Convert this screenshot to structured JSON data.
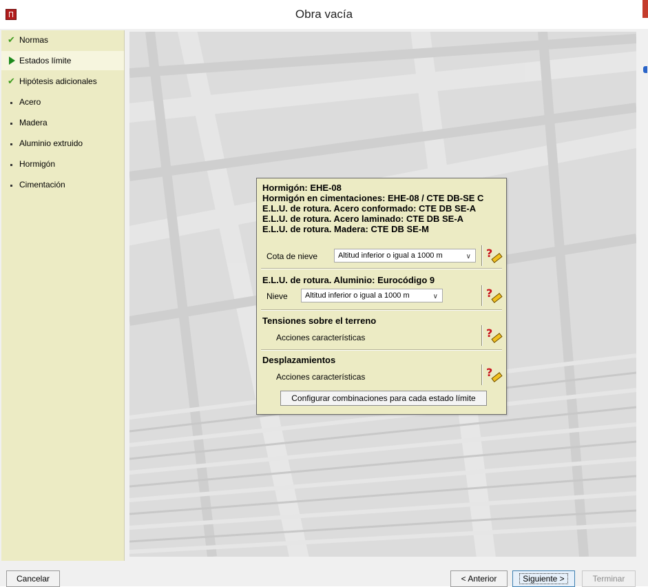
{
  "window": {
    "title": "Obra vacía",
    "close_label": "×"
  },
  "sidebar": {
    "items": [
      {
        "label": "Normas",
        "icon": "check-icon",
        "active": false
      },
      {
        "label": "Estados límite",
        "icon": "arrow-icon",
        "active": true
      },
      {
        "label": "Hipótesis adicionales",
        "icon": "check-icon",
        "active": false
      },
      {
        "label": "Acero",
        "icon": "bullet-icon",
        "active": false
      },
      {
        "label": "Madera",
        "icon": "bullet-icon",
        "active": false
      },
      {
        "label": "Aluminio extruido",
        "icon": "bullet-icon",
        "active": false
      },
      {
        "label": "Hormigón",
        "icon": "bullet-icon",
        "active": false
      },
      {
        "label": "Cimentación",
        "icon": "bullet-icon",
        "active": false
      }
    ]
  },
  "panel": {
    "lines": [
      "Hormigón: EHE-08",
      "Hormigón en cimentaciones: EHE-08 / CTE DB-SE C",
      "E.L.U. de rotura. Acero conformado: CTE DB SE-A",
      "E.L.U. de rotura. Acero laminado: CTE DB SE-A",
      "E.L.U. de rotura. Madera: CTE DB SE-M"
    ],
    "cota_label": "Cota de nieve",
    "cota_value": "Altitud inferior o igual a 1000 m",
    "aluminio_title": "E.L.U. de rotura. Aluminio: Eurocódigo 9",
    "nieve_label": "Nieve",
    "nieve_value": "Altitud inferior o igual a 1000 m",
    "tensiones_title": "Tensiones sobre el terreno",
    "tensiones_sub": "Acciones características",
    "desplazamientos_title": "Desplazamientos",
    "desplazamientos_sub": "Acciones características",
    "config_button": "Configurar combinaciones para cada estado límite"
  },
  "footer": {
    "cancel": "Cancelar",
    "previous": "< Anterior",
    "next": "Siguiente >",
    "finish": "Terminar"
  },
  "colors": {
    "panel_bg": "#ecebc4",
    "sidebar_bg": "#ecebc4",
    "canvas_bg": "#dcdcdc",
    "check_green": "#3d9a1d"
  }
}
